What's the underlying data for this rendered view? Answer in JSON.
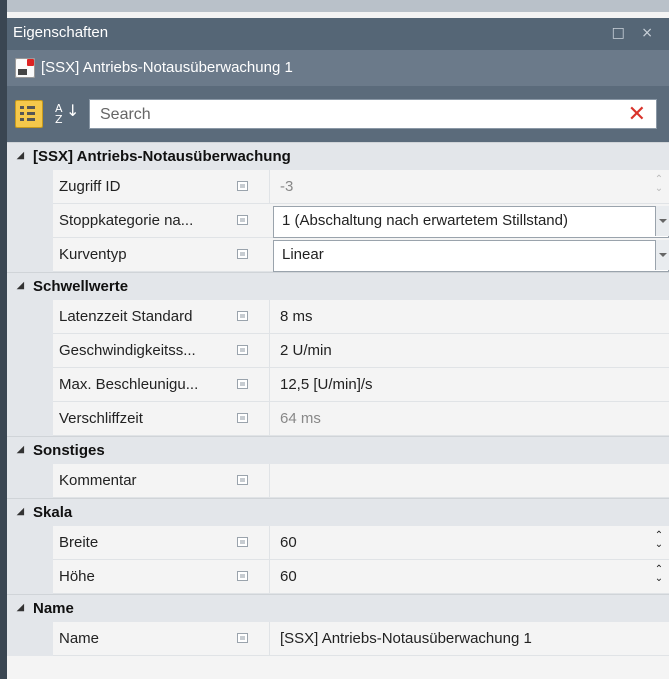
{
  "window": {
    "title": "Eigenschaften",
    "controls": "□ ×"
  },
  "object": {
    "name": "[SSX] Antriebs-Notausüberwachung 1"
  },
  "toolbar": {
    "search_placeholder": "Search"
  },
  "categories": [
    {
      "label": "[SSX] Antriebs-Notausüberwachung",
      "rows": [
        {
          "name": "Zugriff ID",
          "value": "-3",
          "readonly": true,
          "spinner": "dim"
        },
        {
          "name": "Stoppkategorie na...",
          "value": "1 (Abschaltung nach erwartetem Stillstand)",
          "dropdown": true
        },
        {
          "name": "Kurventyp",
          "value": "Linear",
          "dropdown": true
        }
      ]
    },
    {
      "label": "Schwellwerte",
      "rows": [
        {
          "name": "Latenzzeit Standard",
          "value": "8 ms"
        },
        {
          "name": "Geschwindigkeitss...",
          "value": "2 U/min"
        },
        {
          "name": "Max. Beschleunigu...",
          "value": "12,5 [U/min]/s"
        },
        {
          "name": "Verschliffzeit",
          "value": "64 ms",
          "readonly": true
        }
      ]
    },
    {
      "label": "Sonstiges",
      "rows": [
        {
          "name": "Kommentar",
          "value": ""
        }
      ]
    },
    {
      "label": "Skala",
      "rows": [
        {
          "name": "Breite",
          "value": "60",
          "spinner": "on"
        },
        {
          "name": "Höhe",
          "value": "60",
          "spinner": "on"
        }
      ]
    },
    {
      "label": "Name",
      "rows": [
        {
          "name": "Name",
          "value": "[SSX] Antriebs-Notausüberwachung 1"
        }
      ]
    }
  ]
}
